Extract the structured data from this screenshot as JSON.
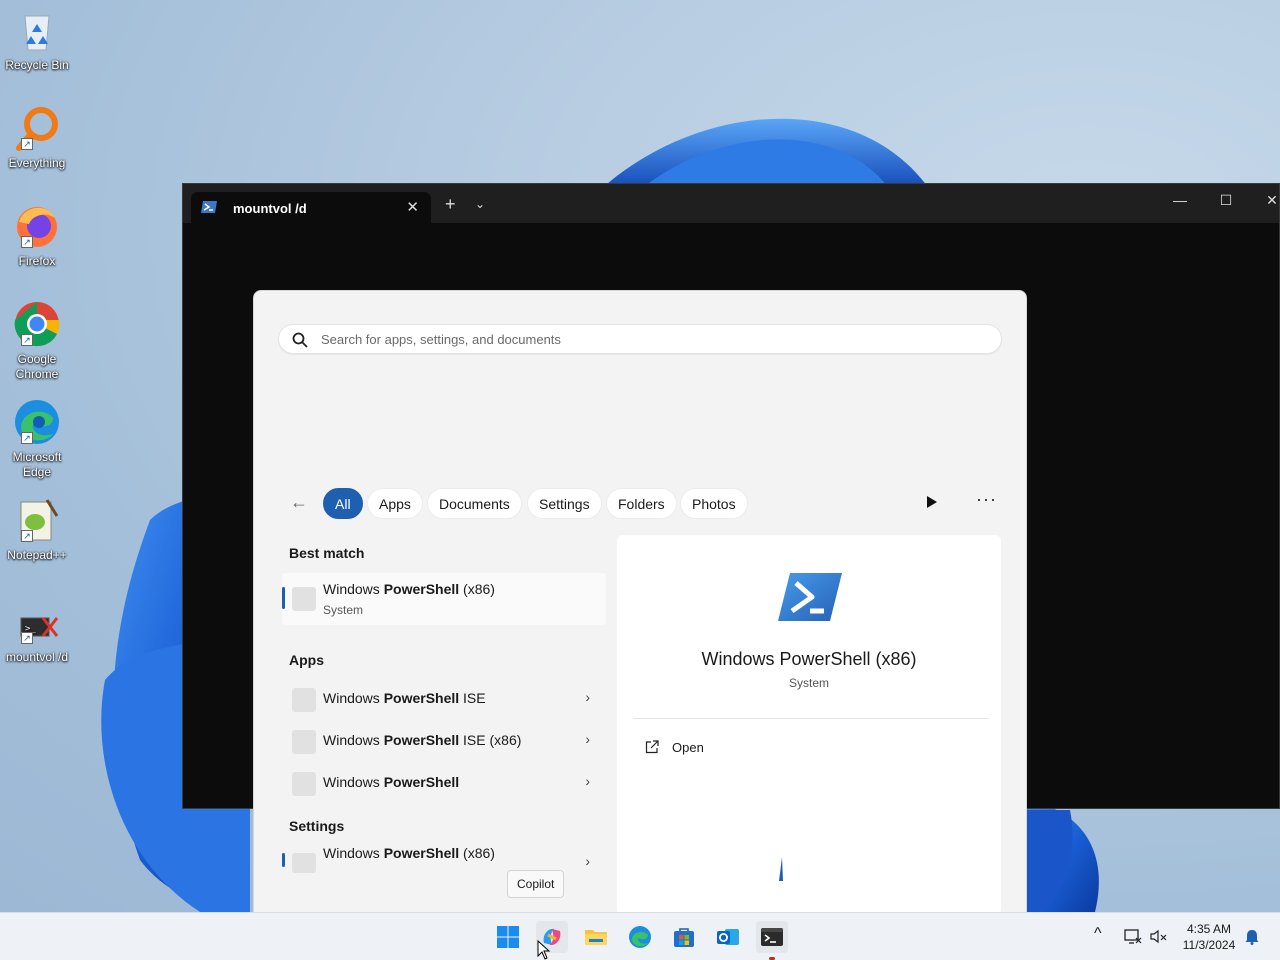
{
  "desktop": {
    "icons": [
      {
        "label": "Recycle Bin",
        "icon": "recycle-bin-icon"
      },
      {
        "label": "Everything",
        "icon": "everything-search-icon"
      },
      {
        "label": "Firefox",
        "icon": "firefox-icon"
      },
      {
        "label": "Google Chrome",
        "icon": "chrome-icon"
      },
      {
        "label": "Microsoft Edge",
        "icon": "edge-icon"
      },
      {
        "label": "Notepad++",
        "icon": "notepadpp-icon"
      },
      {
        "label": "mountvol /d",
        "icon": "mountvol-shortcut-icon"
      }
    ]
  },
  "terminal": {
    "tab_title": "mountvol /d",
    "new_tab": "+",
    "dropdown": "⌄",
    "minimize": "—",
    "maximize": "☐",
    "close": "✕"
  },
  "search": {
    "placeholder": "Search for apps, settings, and documents",
    "value": ""
  },
  "filters": {
    "back": "←",
    "chips": [
      "All",
      "Apps",
      "Documents",
      "Settings",
      "Folders",
      "Photos"
    ],
    "active": "All",
    "more": "···"
  },
  "results": {
    "best_match_heading": "Best match",
    "best_match": {
      "name_prefix": "Windows ",
      "name_bold": "PowerShell",
      "name_suffix": " (x86)",
      "sub": "System"
    },
    "apps_heading": "Apps",
    "apps": [
      {
        "name_prefix": "Windows ",
        "name_bold": "PowerShell",
        "name_suffix": " ISE"
      },
      {
        "name_prefix": "Windows ",
        "name_bold": "PowerShell",
        "name_suffix": " ISE (x86)"
      },
      {
        "name_prefix": "Windows ",
        "name_bold": "PowerShell",
        "name_suffix": ""
      }
    ],
    "settings_heading": "Settings",
    "settings_item": {
      "name_prefix": "Windows ",
      "name_bold": "PowerShell",
      "name_suffix": " (x86)"
    }
  },
  "details": {
    "title": "Windows PowerShell (x86)",
    "subtitle": "System",
    "open_label": "Open"
  },
  "tooltip": "Copilot",
  "taskbar": {
    "apps": [
      "start-icon",
      "copilot-icon",
      "file-explorer-icon",
      "edge-icon",
      "store-icon",
      "outlook-icon",
      "terminal-icon"
    ],
    "tray_chevron": "^",
    "time": "4:35 AM",
    "date": "11/3/2024"
  },
  "colors": {
    "accent": "#1f5faf",
    "terminal_bg": "#0c0c0c",
    "taskbar_bg": "#eef1f5"
  }
}
